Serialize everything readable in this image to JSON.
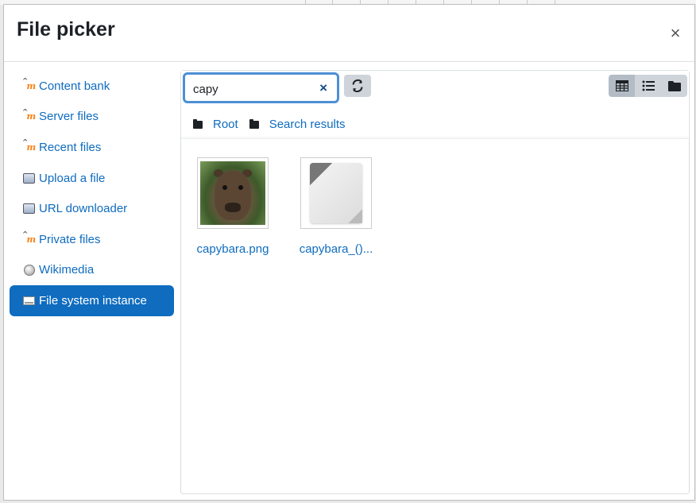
{
  "dialog": {
    "title": "File picker",
    "close_label": "×"
  },
  "sidebar": {
    "items": [
      {
        "label": "Content bank",
        "icon": "moodle-icon",
        "active": false
      },
      {
        "label": "Server files",
        "icon": "moodle-icon",
        "active": false
      },
      {
        "label": "Recent files",
        "icon": "moodle-icon",
        "active": false
      },
      {
        "label": "Upload a file",
        "icon": "upload-icon",
        "active": false
      },
      {
        "label": "URL downloader",
        "icon": "url-download-icon",
        "active": false
      },
      {
        "label": "Private files",
        "icon": "moodle-icon",
        "active": false
      },
      {
        "label": "Wikimedia",
        "icon": "wikimedia-icon",
        "active": false
      },
      {
        "label": "File system instance",
        "icon": "file-system-icon",
        "active": true
      }
    ]
  },
  "search": {
    "value": "capy",
    "clear_label": "×"
  },
  "toolbar": {
    "refresh_icon": "refresh-icon",
    "views": [
      "grid-view-icon",
      "list-view-icon",
      "tree-view-icon"
    ],
    "active_view": "grid-view-icon"
  },
  "breadcrumb": {
    "items": [
      "Root",
      "Search results"
    ]
  },
  "files": [
    {
      "name": "capybara.png",
      "type": "image"
    },
    {
      "name": "capybara_()...",
      "type": "document"
    }
  ],
  "colors": {
    "link": "#0f6cbf",
    "active_bg": "#0f6cbf",
    "focus_border": "#4d8fd6",
    "button_bg": "#ced4da"
  }
}
